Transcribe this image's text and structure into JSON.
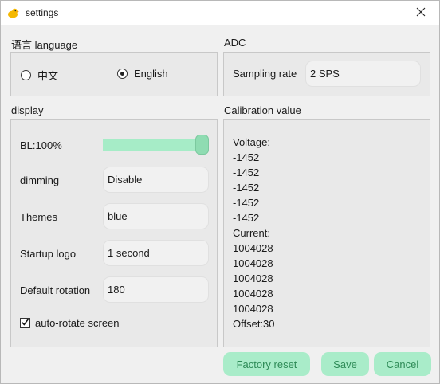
{
  "window": {
    "title": "settings"
  },
  "language": {
    "section_label": "语言 language",
    "options": [
      {
        "label": "中文",
        "selected": false
      },
      {
        "label": "English",
        "selected": true
      }
    ]
  },
  "adc": {
    "section_label": "ADC",
    "sampling_rate_label": "Sampling rate",
    "sampling_rate_value": "2 SPS"
  },
  "display": {
    "section_label": "display",
    "backlight_label": "BL:100%",
    "backlight_level": 1.0,
    "dimming_label": "dimming",
    "dimming_value": "Disable",
    "themes_label": "Themes",
    "themes_value": "blue",
    "startup_logo_label": "Startup logo",
    "startup_logo_value": "1 second",
    "rotation_label": "Default rotation",
    "rotation_value": "180",
    "auto_rotate_label": "auto-rotate screen",
    "auto_rotate_checked": true
  },
  "calibration": {
    "section_label": "Calibration value",
    "lines": [
      "Voltage:",
      "-1452",
      "-1452",
      "-1452",
      "-1452",
      "-1452",
      "Current:",
      "1004028",
      "1004028",
      "1004028",
      "1004028",
      "1004028",
      "Offset:30"
    ]
  },
  "buttons": {
    "factory_reset": "Factory reset",
    "save": "Save",
    "cancel": "Cancel"
  },
  "colors": {
    "accent": "#a9ecc9",
    "accent_text": "#2e8b57",
    "slider_fill": "#a6ecc7"
  },
  "icons": {
    "app": "duck-icon",
    "close": "close-icon",
    "check": "check-icon"
  }
}
